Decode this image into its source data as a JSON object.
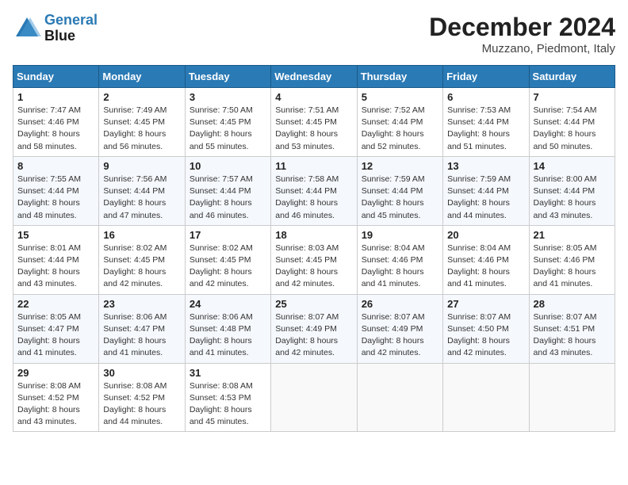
{
  "header": {
    "logo_line1": "General",
    "logo_line2": "Blue",
    "month": "December 2024",
    "location": "Muzzano, Piedmont, Italy"
  },
  "weekdays": [
    "Sunday",
    "Monday",
    "Tuesday",
    "Wednesday",
    "Thursday",
    "Friday",
    "Saturday"
  ],
  "weeks": [
    [
      {
        "day": "1",
        "sunrise": "7:47 AM",
        "sunset": "4:46 PM",
        "daylight": "8 hours and 58 minutes."
      },
      {
        "day": "2",
        "sunrise": "7:49 AM",
        "sunset": "4:45 PM",
        "daylight": "8 hours and 56 minutes."
      },
      {
        "day": "3",
        "sunrise": "7:50 AM",
        "sunset": "4:45 PM",
        "daylight": "8 hours and 55 minutes."
      },
      {
        "day": "4",
        "sunrise": "7:51 AM",
        "sunset": "4:45 PM",
        "daylight": "8 hours and 53 minutes."
      },
      {
        "day": "5",
        "sunrise": "7:52 AM",
        "sunset": "4:44 PM",
        "daylight": "8 hours and 52 minutes."
      },
      {
        "day": "6",
        "sunrise": "7:53 AM",
        "sunset": "4:44 PM",
        "daylight": "8 hours and 51 minutes."
      },
      {
        "day": "7",
        "sunrise": "7:54 AM",
        "sunset": "4:44 PM",
        "daylight": "8 hours and 50 minutes."
      }
    ],
    [
      {
        "day": "8",
        "sunrise": "7:55 AM",
        "sunset": "4:44 PM",
        "daylight": "8 hours and 48 minutes."
      },
      {
        "day": "9",
        "sunrise": "7:56 AM",
        "sunset": "4:44 PM",
        "daylight": "8 hours and 47 minutes."
      },
      {
        "day": "10",
        "sunrise": "7:57 AM",
        "sunset": "4:44 PM",
        "daylight": "8 hours and 46 minutes."
      },
      {
        "day": "11",
        "sunrise": "7:58 AM",
        "sunset": "4:44 PM",
        "daylight": "8 hours and 46 minutes."
      },
      {
        "day": "12",
        "sunrise": "7:59 AM",
        "sunset": "4:44 PM",
        "daylight": "8 hours and 45 minutes."
      },
      {
        "day": "13",
        "sunrise": "7:59 AM",
        "sunset": "4:44 PM",
        "daylight": "8 hours and 44 minutes."
      },
      {
        "day": "14",
        "sunrise": "8:00 AM",
        "sunset": "4:44 PM",
        "daylight": "8 hours and 43 minutes."
      }
    ],
    [
      {
        "day": "15",
        "sunrise": "8:01 AM",
        "sunset": "4:44 PM",
        "daylight": "8 hours and 43 minutes."
      },
      {
        "day": "16",
        "sunrise": "8:02 AM",
        "sunset": "4:45 PM",
        "daylight": "8 hours and 42 minutes."
      },
      {
        "day": "17",
        "sunrise": "8:02 AM",
        "sunset": "4:45 PM",
        "daylight": "8 hours and 42 minutes."
      },
      {
        "day": "18",
        "sunrise": "8:03 AM",
        "sunset": "4:45 PM",
        "daylight": "8 hours and 42 minutes."
      },
      {
        "day": "19",
        "sunrise": "8:04 AM",
        "sunset": "4:46 PM",
        "daylight": "8 hours and 41 minutes."
      },
      {
        "day": "20",
        "sunrise": "8:04 AM",
        "sunset": "4:46 PM",
        "daylight": "8 hours and 41 minutes."
      },
      {
        "day": "21",
        "sunrise": "8:05 AM",
        "sunset": "4:46 PM",
        "daylight": "8 hours and 41 minutes."
      }
    ],
    [
      {
        "day": "22",
        "sunrise": "8:05 AM",
        "sunset": "4:47 PM",
        "daylight": "8 hours and 41 minutes."
      },
      {
        "day": "23",
        "sunrise": "8:06 AM",
        "sunset": "4:47 PM",
        "daylight": "8 hours and 41 minutes."
      },
      {
        "day": "24",
        "sunrise": "8:06 AM",
        "sunset": "4:48 PM",
        "daylight": "8 hours and 41 minutes."
      },
      {
        "day": "25",
        "sunrise": "8:07 AM",
        "sunset": "4:49 PM",
        "daylight": "8 hours and 42 minutes."
      },
      {
        "day": "26",
        "sunrise": "8:07 AM",
        "sunset": "4:49 PM",
        "daylight": "8 hours and 42 minutes."
      },
      {
        "day": "27",
        "sunrise": "8:07 AM",
        "sunset": "4:50 PM",
        "daylight": "8 hours and 42 minutes."
      },
      {
        "day": "28",
        "sunrise": "8:07 AM",
        "sunset": "4:51 PM",
        "daylight": "8 hours and 43 minutes."
      }
    ],
    [
      {
        "day": "29",
        "sunrise": "8:08 AM",
        "sunset": "4:52 PM",
        "daylight": "8 hours and 43 minutes."
      },
      {
        "day": "30",
        "sunrise": "8:08 AM",
        "sunset": "4:52 PM",
        "daylight": "8 hours and 44 minutes."
      },
      {
        "day": "31",
        "sunrise": "8:08 AM",
        "sunset": "4:53 PM",
        "daylight": "8 hours and 45 minutes."
      },
      null,
      null,
      null,
      null
    ]
  ]
}
